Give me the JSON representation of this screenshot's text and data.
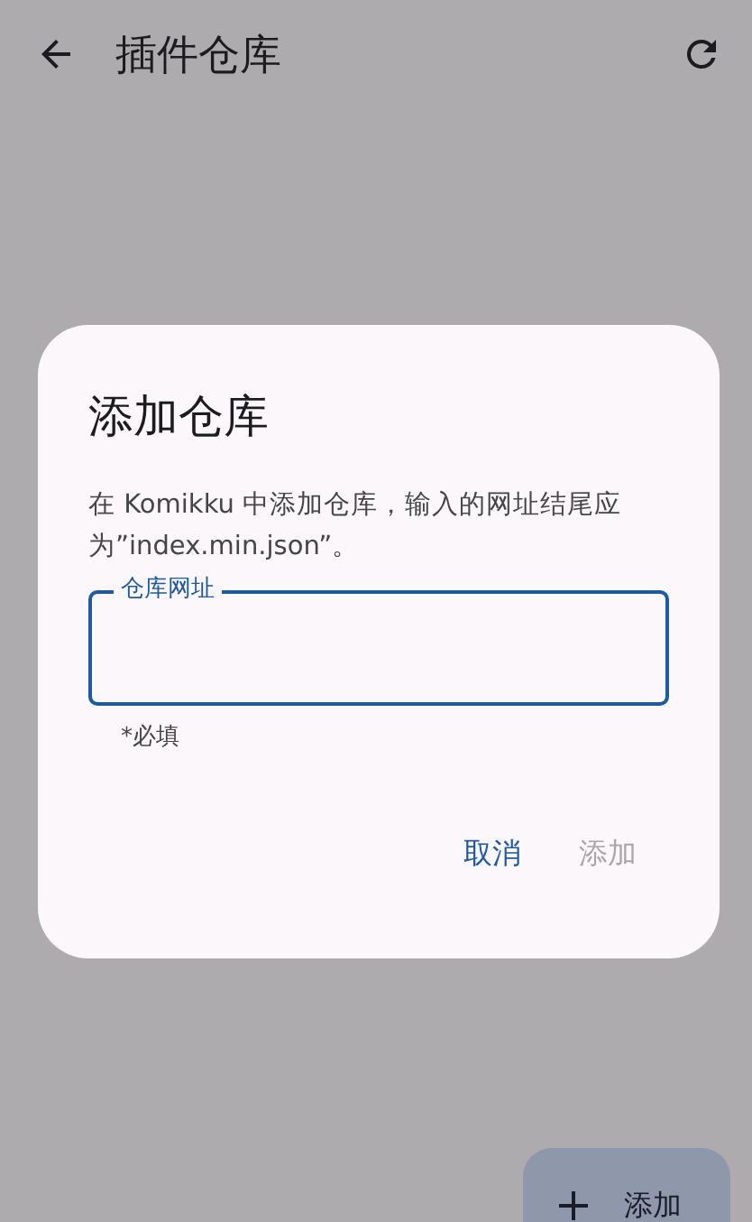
{
  "app_bar": {
    "title": "插件仓库"
  },
  "dialog": {
    "title": "添加仓库",
    "message": "在 Komikku 中添加仓库，输入的网址结尾应为”index.min.json”。",
    "field": {
      "label": "仓库网址",
      "focused": true,
      "helper": "*必填"
    },
    "buttons": [
      {
        "label": "取消",
        "disabled": false
      },
      {
        "label": "添加",
        "disabled": true
      }
    ]
  },
  "fab": {
    "label": "添加"
  }
}
